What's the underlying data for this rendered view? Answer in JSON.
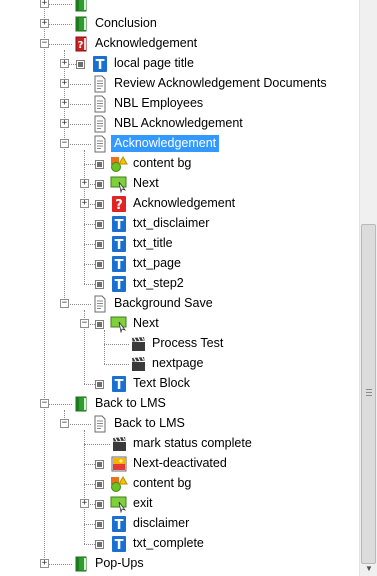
{
  "tree": {
    "nodes": [
      {
        "level": 1,
        "label": "",
        "icon": "green-book-icon",
        "expander": "plus",
        "checkbox": false,
        "partial": true
      },
      {
        "level": 1,
        "label": "Conclusion",
        "icon": "green-book-icon",
        "expander": "plus",
        "checkbox": false
      },
      {
        "level": 1,
        "label": "Acknowledgement",
        "icon": "red-book-question-icon",
        "expander": "minus",
        "checkbox": false
      },
      {
        "level": 2,
        "label": "local page title",
        "icon": "text-object-icon",
        "expander": "plus",
        "checkbox": true
      },
      {
        "level": 2,
        "label": "Review Acknowledgement Documents",
        "icon": "page-icon",
        "expander": "plus",
        "checkbox": false
      },
      {
        "level": 2,
        "label": "NBL Employees",
        "icon": "page-icon",
        "expander": "plus",
        "checkbox": false
      },
      {
        "level": 2,
        "label": "NBL Acknowledgement",
        "icon": "page-icon",
        "expander": "plus",
        "checkbox": false
      },
      {
        "level": 2,
        "label": "Acknowledgement",
        "icon": "page-icon",
        "expander": "minus",
        "checkbox": false,
        "selected": true
      },
      {
        "level": 3,
        "label": "content bg",
        "icon": "shapes-icon",
        "expander": "",
        "checkbox": true
      },
      {
        "level": 3,
        "label": "Next",
        "icon": "button-object-icon",
        "expander": "plus",
        "checkbox": true
      },
      {
        "level": 3,
        "label": "Acknowledgement",
        "icon": "question-icon",
        "expander": "plus",
        "checkbox": true
      },
      {
        "level": 3,
        "label": "txt_disclaimer",
        "icon": "text-object-icon",
        "expander": "",
        "checkbox": true
      },
      {
        "level": 3,
        "label": "txt_title",
        "icon": "text-object-icon",
        "expander": "",
        "checkbox": true
      },
      {
        "level": 3,
        "label": "txt_page",
        "icon": "text-object-icon",
        "expander": "",
        "checkbox": true
      },
      {
        "level": 3,
        "label": "txt_step2",
        "icon": "text-object-icon",
        "expander": "",
        "checkbox": true
      },
      {
        "level": 2,
        "label": "Background Save",
        "icon": "page-icon",
        "expander": "minus",
        "checkbox": false
      },
      {
        "level": 3,
        "label": "Next",
        "icon": "button-object-icon",
        "expander": "minus",
        "checkbox": true
      },
      {
        "level": 4,
        "label": "Process Test",
        "icon": "action-clapper-icon",
        "expander": "",
        "checkbox": false
      },
      {
        "level": 4,
        "label": "nextpage",
        "icon": "action-clapper-icon",
        "expander": "",
        "checkbox": false
      },
      {
        "level": 3,
        "label": "Text Block",
        "icon": "text-object-icon",
        "expander": "",
        "checkbox": true
      },
      {
        "level": 1,
        "label": "Back to LMS",
        "icon": "green-book-icon",
        "expander": "minus",
        "checkbox": false
      },
      {
        "level": 2,
        "label": "Back to LMS",
        "icon": "page-icon",
        "expander": "minus",
        "checkbox": false
      },
      {
        "level": 3,
        "label": "mark status complete",
        "icon": "action-clapper-icon",
        "expander": "",
        "checkbox": false
      },
      {
        "level": 3,
        "label": "Next-deactivated",
        "icon": "image-object-icon",
        "expander": "",
        "checkbox": true
      },
      {
        "level": 3,
        "label": "content bg",
        "icon": "shapes-icon",
        "expander": "",
        "checkbox": true
      },
      {
        "level": 3,
        "label": "exit",
        "icon": "button-object-icon",
        "expander": "plus",
        "checkbox": true
      },
      {
        "level": 3,
        "label": "disclaimer",
        "icon": "text-object-icon",
        "expander": "",
        "checkbox": true
      },
      {
        "level": 3,
        "label": "txt_complete",
        "icon": "text-object-icon",
        "expander": "",
        "checkbox": true
      },
      {
        "level": 1,
        "label": "Pop-Ups",
        "icon": "green-book-icon",
        "expander": "plus",
        "checkbox": false
      }
    ]
  },
  "scrollbar": {
    "thumb_position": "lower",
    "down_arrow": "▼"
  },
  "colors": {
    "selection": "#3399ff",
    "book_green": "#2e9d2e",
    "book_red": "#cc1f1f",
    "text_icon_blue": "#1a6fd0",
    "dotted_line": "#8a8a8a"
  }
}
